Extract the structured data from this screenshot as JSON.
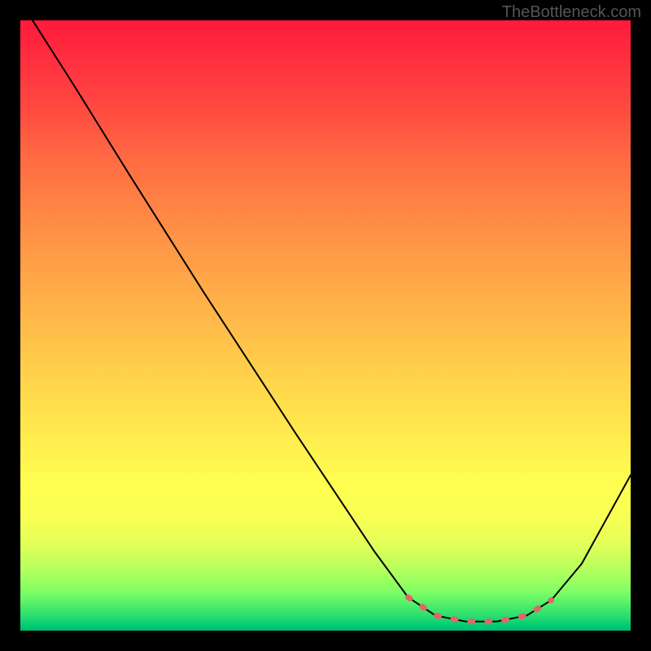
{
  "watermark": "TheBottleneck.com",
  "chart_data": {
    "type": "line",
    "title": "",
    "xlabel": "",
    "ylabel": "",
    "xlim": [
      0,
      100
    ],
    "ylim": [
      0,
      100
    ],
    "series": [
      {
        "name": "curve",
        "color": "#000000",
        "stroke_width": 2,
        "points": [
          {
            "x": 2.0,
            "y": 100.0
          },
          {
            "x": 9.0,
            "y": 89.0
          },
          {
            "x": 18.0,
            "y": 74.5
          },
          {
            "x": 30.0,
            "y": 55.5
          },
          {
            "x": 45.0,
            "y": 32.5
          },
          {
            "x": 58.0,
            "y": 13.0
          },
          {
            "x": 63.5,
            "y": 5.5
          },
          {
            "x": 68.0,
            "y": 2.5
          },
          {
            "x": 73.0,
            "y": 1.5
          },
          {
            "x": 78.0,
            "y": 1.5
          },
          {
            "x": 83.0,
            "y": 2.5
          },
          {
            "x": 87.0,
            "y": 5.0
          },
          {
            "x": 92.0,
            "y": 11.0
          },
          {
            "x": 100.0,
            "y": 25.5
          }
        ]
      },
      {
        "name": "valley-marker",
        "color": "#e06666",
        "stroke_width": 6,
        "dashed": true,
        "points": [
          {
            "x": 63.5,
            "y": 5.5
          },
          {
            "x": 68.0,
            "y": 2.5
          },
          {
            "x": 73.0,
            "y": 1.5
          },
          {
            "x": 78.0,
            "y": 1.5
          },
          {
            "x": 83.0,
            "y": 2.5
          },
          {
            "x": 87.0,
            "y": 5.0
          }
        ]
      }
    ],
    "gradient": {
      "type": "vertical",
      "stops": [
        {
          "pos": 0.0,
          "color": "#ff1a3a"
        },
        {
          "pos": 0.5,
          "color": "#ffc64a"
        },
        {
          "pos": 0.76,
          "color": "#ffff50"
        },
        {
          "pos": 0.95,
          "color": "#60f568"
        },
        {
          "pos": 1.0,
          "color": "#00b870"
        }
      ]
    }
  }
}
